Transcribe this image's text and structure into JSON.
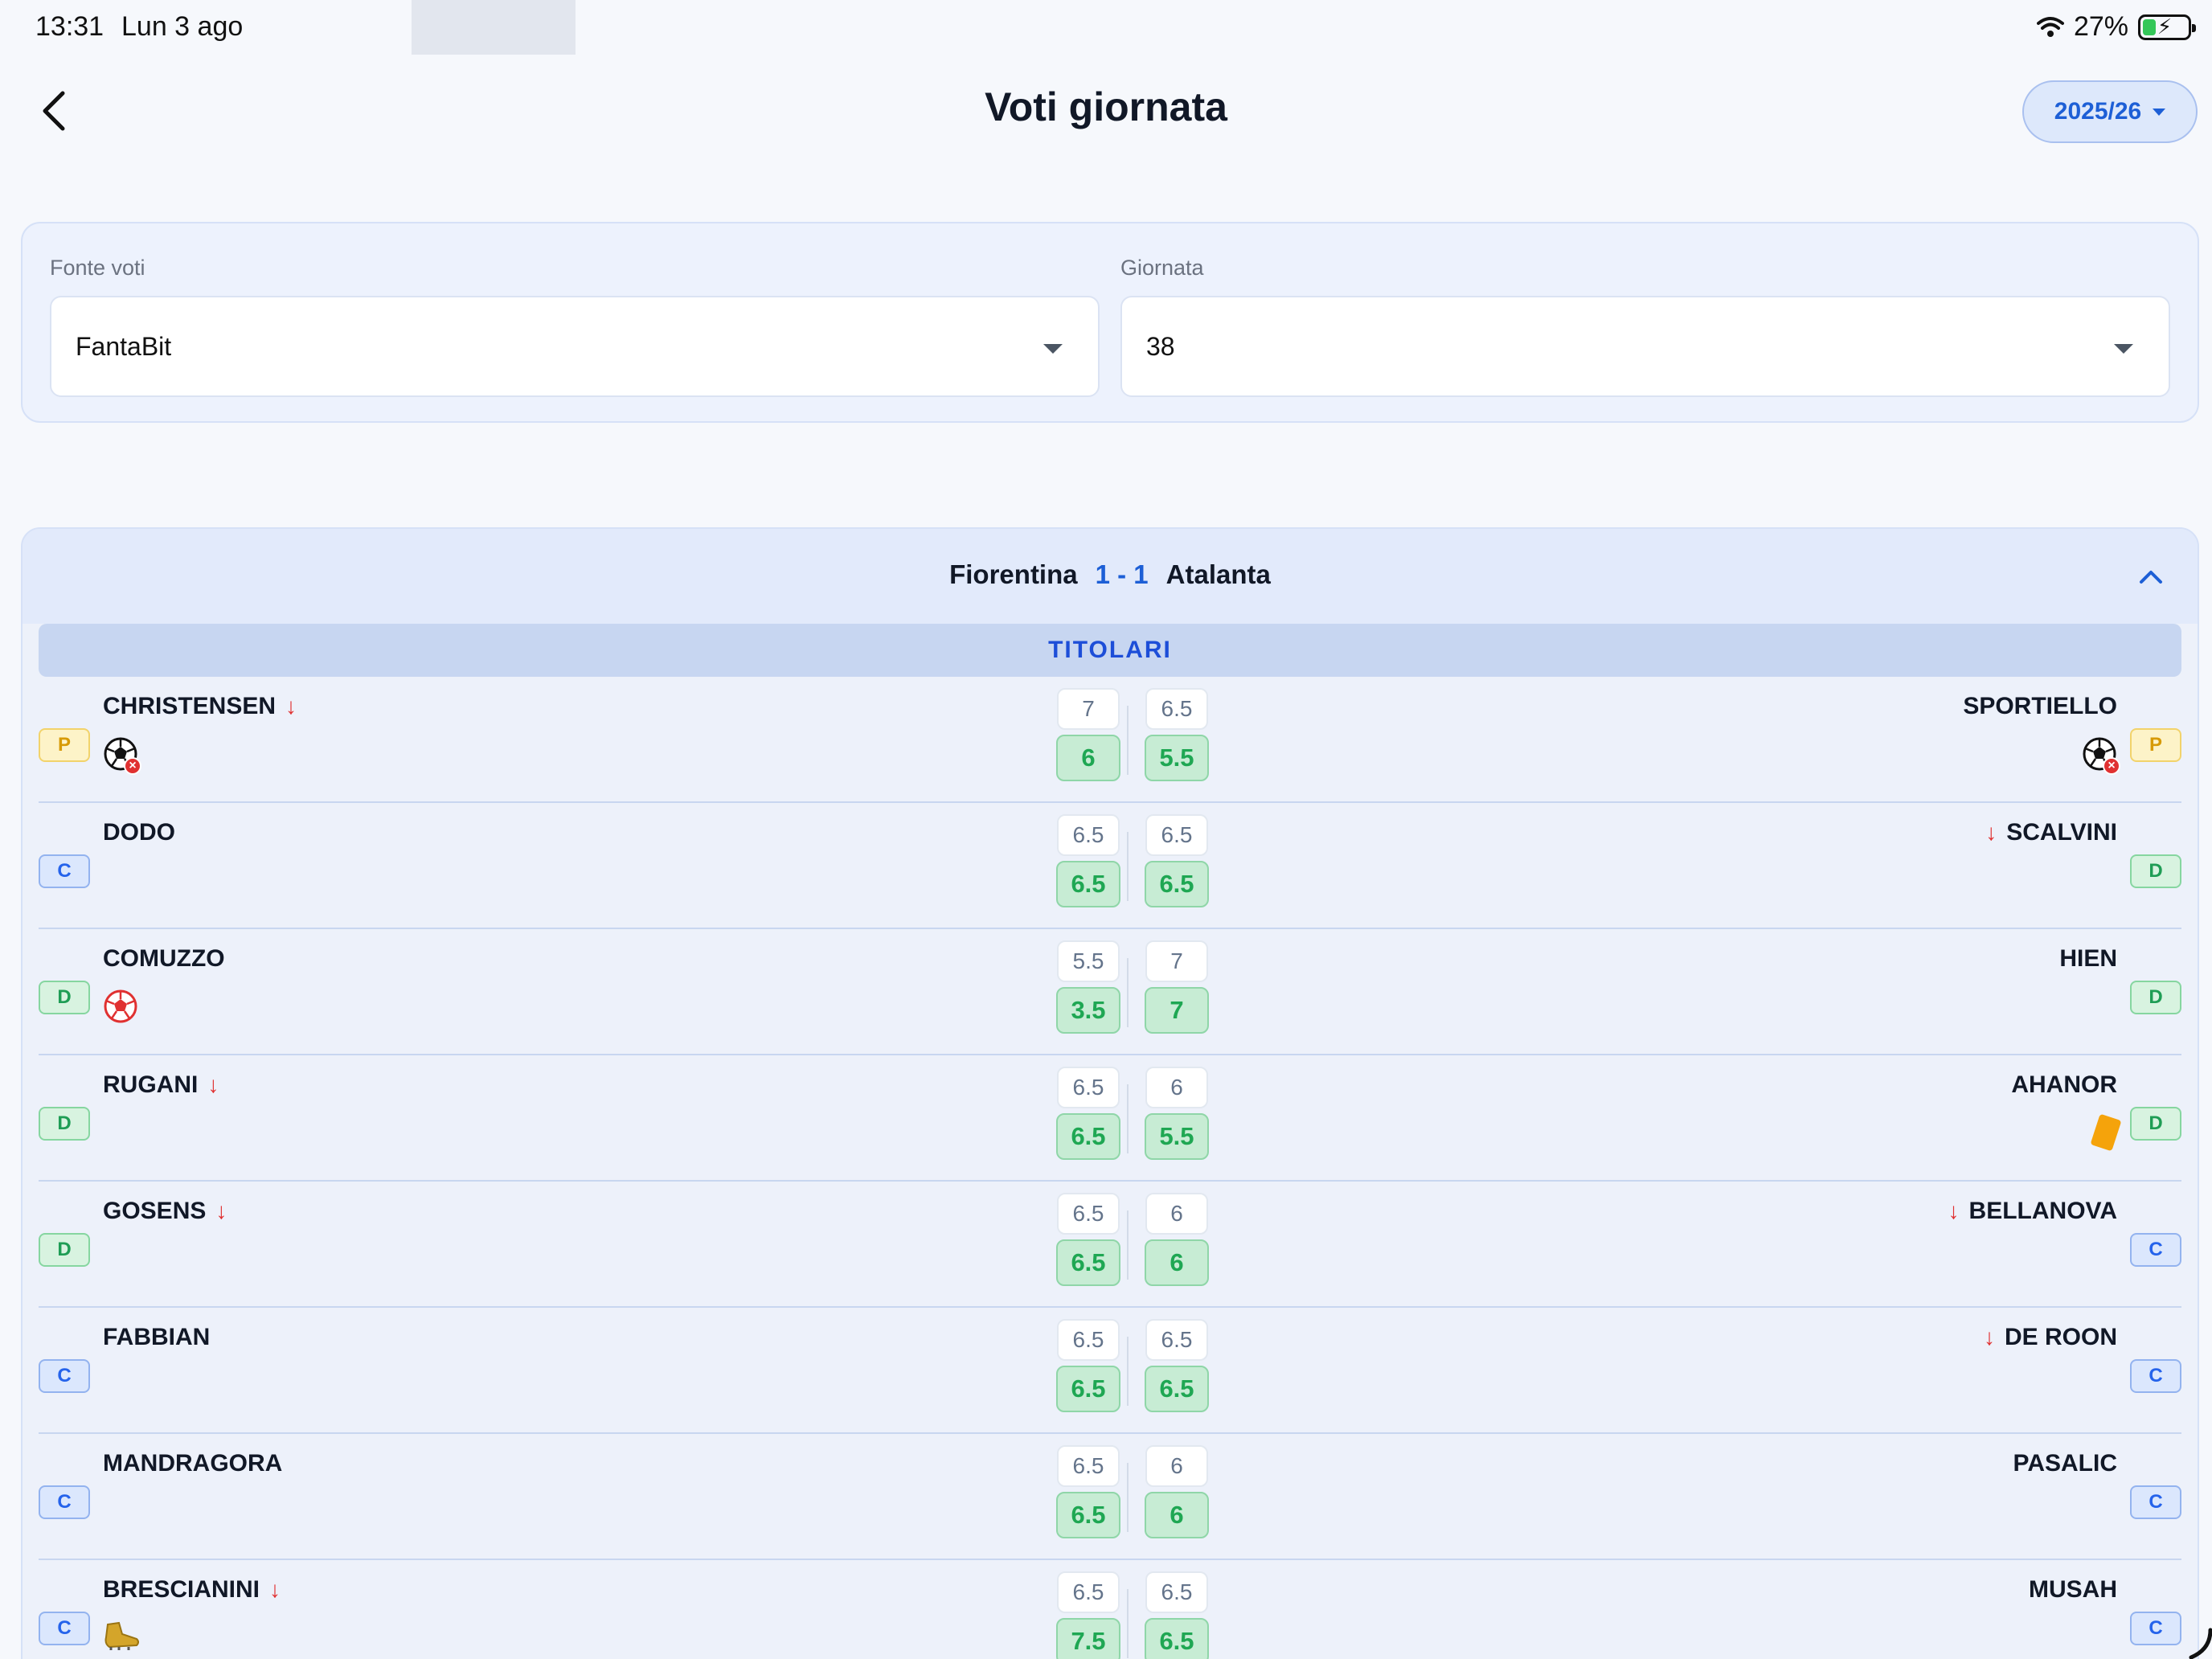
{
  "status": {
    "time": "13:31",
    "date": "Lun 3 ago",
    "battery": "27%"
  },
  "header": {
    "title": "Voti giornata",
    "season": "2025/26"
  },
  "filters": {
    "source_label": "Fonte voti",
    "source_value": "FantaBit",
    "round_label": "Giornata",
    "round_value": "38"
  },
  "match": {
    "home": "Fiorentina",
    "score": "1 - 1",
    "away": "Atalanta",
    "section": "TITOLARI"
  },
  "colors": {
    "accent": "#1d5fd6",
    "positive": "#1fa753",
    "negative": "#e03131"
  },
  "rows": [
    {
      "left_role": "P",
      "left_name": "CHRISTENSEN",
      "left_arrow": true,
      "left_events": [
        "goal-conceded"
      ],
      "vote_l": "7",
      "fanta_l": "6",
      "vote_r": "6.5",
      "fanta_r": "5.5",
      "right_role": "P",
      "right_name": "SPORTIELLO",
      "right_arrow": false,
      "right_events": [
        "goal-conceded"
      ]
    },
    {
      "left_role": "C",
      "left_name": "DODO",
      "left_arrow": false,
      "left_events": [],
      "vote_l": "6.5",
      "fanta_l": "6.5",
      "vote_r": "6.5",
      "fanta_r": "6.5",
      "right_role": "D",
      "right_name": "SCALVINI",
      "right_arrow": true,
      "right_events": []
    },
    {
      "left_role": "D",
      "left_name": "COMUZZO",
      "left_arrow": false,
      "left_events": [
        "own-goal"
      ],
      "vote_l": "5.5",
      "fanta_l": "3.5",
      "vote_r": "7",
      "fanta_r": "7",
      "right_role": "D",
      "right_name": "HIEN",
      "right_arrow": false,
      "right_events": []
    },
    {
      "left_role": "D",
      "left_name": "RUGANI",
      "left_arrow": true,
      "left_events": [],
      "vote_l": "6.5",
      "fanta_l": "6.5",
      "vote_r": "6",
      "fanta_r": "5.5",
      "right_role": "D",
      "right_name": "AHANOR",
      "right_arrow": false,
      "right_events": [
        "yellow-card"
      ]
    },
    {
      "left_role": "D",
      "left_name": "GOSENS",
      "left_arrow": true,
      "left_events": [],
      "vote_l": "6.5",
      "fanta_l": "6.5",
      "vote_r": "6",
      "fanta_r": "6",
      "right_role": "C",
      "right_name": "BELLANOVA",
      "right_arrow": true,
      "right_events": []
    },
    {
      "left_role": "C",
      "left_name": "FABBIAN",
      "left_arrow": false,
      "left_events": [],
      "vote_l": "6.5",
      "fanta_l": "6.5",
      "vote_r": "6.5",
      "fanta_r": "6.5",
      "right_role": "C",
      "right_name": "DE ROON",
      "right_arrow": true,
      "right_events": []
    },
    {
      "left_role": "C",
      "left_name": "MANDRAGORA",
      "left_arrow": false,
      "left_events": [],
      "vote_l": "6.5",
      "fanta_l": "6.5",
      "vote_r": "6",
      "fanta_r": "6",
      "right_role": "C",
      "right_name": "PASALIC",
      "right_arrow": false,
      "right_events": []
    },
    {
      "left_role": "C",
      "left_name": "BRESCIANINI",
      "left_arrow": true,
      "left_events": [
        "assist"
      ],
      "vote_l": "6.5",
      "fanta_l": "7.5",
      "vote_r": "6.5",
      "fanta_r": "6.5",
      "right_role": "C",
      "right_name": "MUSAH",
      "right_arrow": false,
      "right_events": []
    }
  ]
}
